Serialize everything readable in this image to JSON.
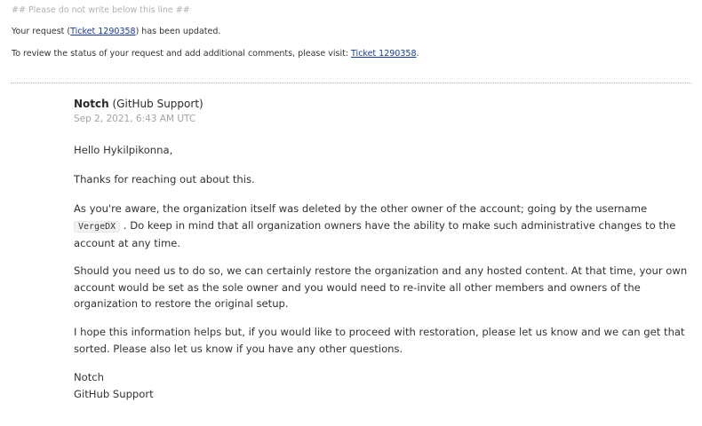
{
  "header": {
    "note": "## Please do not write below this line ##"
  },
  "notice": {
    "line1_prefix": "Your request (",
    "ticket_link": "Ticket 1290358",
    "line1_suffix": ") has been updated.",
    "line2_prefix": "To review the status of your request and add additional comments, please visit: ",
    "line2_suffix": "."
  },
  "message": {
    "author_name": "Notch",
    "author_org": " (GitHub Support)",
    "date": "Sep 2, 2021, 6:43 AM UTC",
    "greeting": "Hello Hykilpikonna,",
    "thanks": "Thanks for reaching out about this.",
    "aware_before": "As you're aware, the organization itself was deleted by the other owner of the account; going by the username ",
    "aware_username": "VergeDX",
    "aware_after": " . Do keep in mind that all organization owners have the ability to make such administrative changes to the account at any time.",
    "should": "Should you need us to do so, we can certainly restore the organization and any hosted content. At that time, your own account would be set as the sole owner and you would need to re-invite all other members and owners of the organization to restore the original setup.",
    "hope": "I hope this information helps but, if you would like to proceed with restoration, please let us know and we can get that sorted. Please also let us know if you have any other questions.",
    "sign_name": "Notch",
    "sign_org": "GitHub Support"
  }
}
